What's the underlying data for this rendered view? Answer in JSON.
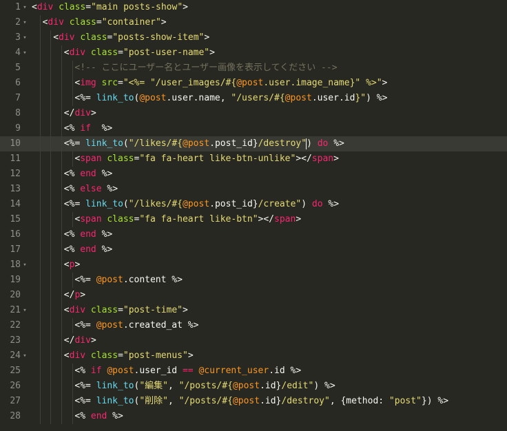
{
  "editor": {
    "active_line": 10,
    "colors": {
      "background": "#272822",
      "active_line": "#393a34",
      "default": "#f8f8f2",
      "tag": "#f92672",
      "attribute": "#a6e22e",
      "string": "#e6db74",
      "comment": "#75715e",
      "keyword": "#f92672",
      "function": "#66d9ef",
      "instance_var": "#fd971f",
      "gutter": "#8f908a"
    },
    "lines": [
      {
        "num": "1",
        "fold": true,
        "indent": 0,
        "tokens": [
          [
            "p",
            "<"
          ],
          [
            "t",
            "div"
          ],
          [
            "a",
            " class"
          ],
          [
            "p",
            "="
          ],
          [
            "s",
            "\"main posts-show\""
          ],
          [
            "p",
            ">"
          ]
        ]
      },
      {
        "num": "2",
        "fold": true,
        "indent": 1,
        "tokens": [
          [
            "p",
            "<"
          ],
          [
            "t",
            "div"
          ],
          [
            "a",
            " class"
          ],
          [
            "p",
            "="
          ],
          [
            "s",
            "\"container\""
          ],
          [
            "p",
            ">"
          ]
        ]
      },
      {
        "num": "3",
        "fold": true,
        "indent": 2,
        "tokens": [
          [
            "p",
            "<"
          ],
          [
            "t",
            "div"
          ],
          [
            "a",
            " class"
          ],
          [
            "p",
            "="
          ],
          [
            "s",
            "\"posts-show-item\""
          ],
          [
            "p",
            ">"
          ]
        ]
      },
      {
        "num": "4",
        "fold": true,
        "indent": 3,
        "tokens": [
          [
            "p",
            "<"
          ],
          [
            "t",
            "div"
          ],
          [
            "a",
            " class"
          ],
          [
            "p",
            "="
          ],
          [
            "s",
            "\"post-user-name\""
          ],
          [
            "p",
            ">"
          ]
        ]
      },
      {
        "num": "5",
        "fold": false,
        "indent": 4,
        "tokens": [
          [
            "c",
            "<!-- ここにユーザー名とユーザー画像を表示してください -->"
          ]
        ]
      },
      {
        "num": "6",
        "fold": false,
        "indent": 4,
        "tokens": [
          [
            "p",
            "<"
          ],
          [
            "t",
            "img"
          ],
          [
            "a",
            " src"
          ],
          [
            "p",
            "="
          ],
          [
            "s",
            "\"<%= \"/user_images/#{"
          ],
          [
            "i",
            "@post"
          ],
          [
            "s",
            ".user.image_name}\" %>\""
          ],
          [
            "p",
            ">"
          ]
        ]
      },
      {
        "num": "7",
        "fold": false,
        "indent": 4,
        "tokens": [
          [
            "p",
            "<%= "
          ],
          [
            "f",
            "link_to"
          ],
          [
            "p",
            "("
          ],
          [
            "i",
            "@post"
          ],
          [
            "p",
            ".user.name, "
          ],
          [
            "s",
            "\"/users/#{"
          ],
          [
            "i",
            "@post"
          ],
          [
            "p",
            ".user.id"
          ],
          [
            "s",
            "}\""
          ],
          [
            "p",
            ") %>"
          ]
        ]
      },
      {
        "num": "8",
        "fold": false,
        "indent": 3,
        "tokens": [
          [
            "p",
            "</"
          ],
          [
            "t",
            "div"
          ],
          [
            "p",
            ">"
          ]
        ]
      },
      {
        "num": "9",
        "fold": false,
        "indent": 3,
        "tokens": [
          [
            "p",
            "<% "
          ],
          [
            "k",
            "if"
          ],
          [
            "p",
            "  %>"
          ]
        ]
      },
      {
        "num": "10",
        "fold": false,
        "indent": 3,
        "tokens": [
          [
            "p",
            "<%= "
          ],
          [
            "f",
            "link_to"
          ],
          [
            "p",
            "("
          ],
          [
            "s",
            "\"/likes/#{"
          ],
          [
            "i",
            "@post"
          ],
          [
            "p",
            ".post_id}"
          ],
          [
            "s",
            "/destroy\""
          ],
          [
            "cur",
            ""
          ],
          [
            "p",
            ") "
          ],
          [
            "k",
            "do"
          ],
          [
            "p",
            " %>"
          ]
        ]
      },
      {
        "num": "11",
        "fold": false,
        "indent": 4,
        "tokens": [
          [
            "p",
            "<"
          ],
          [
            "t",
            "span"
          ],
          [
            "a",
            " class"
          ],
          [
            "p",
            "="
          ],
          [
            "s",
            "\"fa fa-heart like-btn-unlike\""
          ],
          [
            "p",
            "></"
          ],
          [
            "t",
            "span"
          ],
          [
            "p",
            ">"
          ]
        ]
      },
      {
        "num": "12",
        "fold": false,
        "indent": 3,
        "tokens": [
          [
            "p",
            "<% "
          ],
          [
            "k",
            "end"
          ],
          [
            "p",
            " %>"
          ]
        ]
      },
      {
        "num": "13",
        "fold": false,
        "indent": 3,
        "tokens": [
          [
            "p",
            "<% "
          ],
          [
            "k",
            "else"
          ],
          [
            "p",
            " %>"
          ]
        ]
      },
      {
        "num": "14",
        "fold": false,
        "indent": 3,
        "tokens": [
          [
            "p",
            "<%= "
          ],
          [
            "f",
            "link_to"
          ],
          [
            "p",
            "("
          ],
          [
            "s",
            "\"/likes/#{"
          ],
          [
            "i",
            "@post"
          ],
          [
            "p",
            ".post_id}"
          ],
          [
            "s",
            "/create\""
          ],
          [
            "p",
            ") "
          ],
          [
            "k",
            "do"
          ],
          [
            "p",
            " %>"
          ]
        ]
      },
      {
        "num": "15",
        "fold": false,
        "indent": 4,
        "tokens": [
          [
            "p",
            "<"
          ],
          [
            "t",
            "span"
          ],
          [
            "a",
            " class"
          ],
          [
            "p",
            "="
          ],
          [
            "s",
            "\"fa fa-heart like-btn\""
          ],
          [
            "p",
            "></"
          ],
          [
            "t",
            "span"
          ],
          [
            "p",
            ">"
          ]
        ]
      },
      {
        "num": "16",
        "fold": false,
        "indent": 3,
        "tokens": [
          [
            "p",
            "<% "
          ],
          [
            "k",
            "end"
          ],
          [
            "p",
            " %>"
          ]
        ]
      },
      {
        "num": "17",
        "fold": false,
        "indent": 3,
        "tokens": [
          [
            "p",
            "<% "
          ],
          [
            "k",
            "end"
          ],
          [
            "p",
            " %>"
          ]
        ]
      },
      {
        "num": "18",
        "fold": true,
        "indent": 3,
        "tokens": [
          [
            "p",
            "<"
          ],
          [
            "t",
            "p"
          ],
          [
            "p",
            ">"
          ]
        ]
      },
      {
        "num": "19",
        "fold": false,
        "indent": 4,
        "tokens": [
          [
            "p",
            "<%= "
          ],
          [
            "i",
            "@post"
          ],
          [
            "p",
            ".content %>"
          ]
        ]
      },
      {
        "num": "20",
        "fold": false,
        "indent": 3,
        "tokens": [
          [
            "p",
            "</"
          ],
          [
            "t",
            "p"
          ],
          [
            "p",
            ">"
          ]
        ]
      },
      {
        "num": "21",
        "fold": true,
        "indent": 3,
        "tokens": [
          [
            "p",
            "<"
          ],
          [
            "t",
            "div"
          ],
          [
            "a",
            " class"
          ],
          [
            "p",
            "="
          ],
          [
            "s",
            "\"post-time\""
          ],
          [
            "p",
            ">"
          ]
        ]
      },
      {
        "num": "22",
        "fold": false,
        "indent": 4,
        "tokens": [
          [
            "p",
            "<%= "
          ],
          [
            "i",
            "@post"
          ],
          [
            "p",
            ".created_at %>"
          ]
        ]
      },
      {
        "num": "23",
        "fold": false,
        "indent": 3,
        "tokens": [
          [
            "p",
            "</"
          ],
          [
            "t",
            "div"
          ],
          [
            "p",
            ">"
          ]
        ]
      },
      {
        "num": "24",
        "fold": true,
        "indent": 3,
        "tokens": [
          [
            "p",
            "<"
          ],
          [
            "t",
            "div"
          ],
          [
            "a",
            " class"
          ],
          [
            "p",
            "="
          ],
          [
            "s",
            "\"post-menus\""
          ],
          [
            "p",
            ">"
          ]
        ]
      },
      {
        "num": "25",
        "fold": false,
        "indent": 4,
        "tokens": [
          [
            "p",
            "<% "
          ],
          [
            "k",
            "if"
          ],
          [
            "p",
            " "
          ],
          [
            "i",
            "@post"
          ],
          [
            "p",
            ".user_id "
          ],
          [
            "k",
            "=="
          ],
          [
            "p",
            " "
          ],
          [
            "i",
            "@current_user"
          ],
          [
            "p",
            ".id %>"
          ]
        ]
      },
      {
        "num": "26",
        "fold": false,
        "indent": 4,
        "tokens": [
          [
            "p",
            "<%= "
          ],
          [
            "f",
            "link_to"
          ],
          [
            "p",
            "("
          ],
          [
            "s",
            "\"編集\""
          ],
          [
            "p",
            ", "
          ],
          [
            "s",
            "\"/posts/#{"
          ],
          [
            "i",
            "@post"
          ],
          [
            "p",
            ".id}"
          ],
          [
            "s",
            "/edit\""
          ],
          [
            "p",
            ") %>"
          ]
        ]
      },
      {
        "num": "27",
        "fold": false,
        "indent": 4,
        "tokens": [
          [
            "p",
            "<%= "
          ],
          [
            "f",
            "link_to"
          ],
          [
            "p",
            "("
          ],
          [
            "s",
            "\"削除\""
          ],
          [
            "p",
            ", "
          ],
          [
            "s",
            "\"/posts/#{"
          ],
          [
            "i",
            "@post"
          ],
          [
            "p",
            ".id}"
          ],
          [
            "s",
            "/destroy\""
          ],
          [
            "p",
            ", {method: "
          ],
          [
            "s",
            "\"post\""
          ],
          [
            "p",
            "}) %>"
          ]
        ]
      },
      {
        "num": "28",
        "fold": false,
        "indent": 4,
        "tokens": [
          [
            "p",
            "<% "
          ],
          [
            "k",
            "end"
          ],
          [
            "p",
            " %>"
          ]
        ]
      }
    ]
  }
}
